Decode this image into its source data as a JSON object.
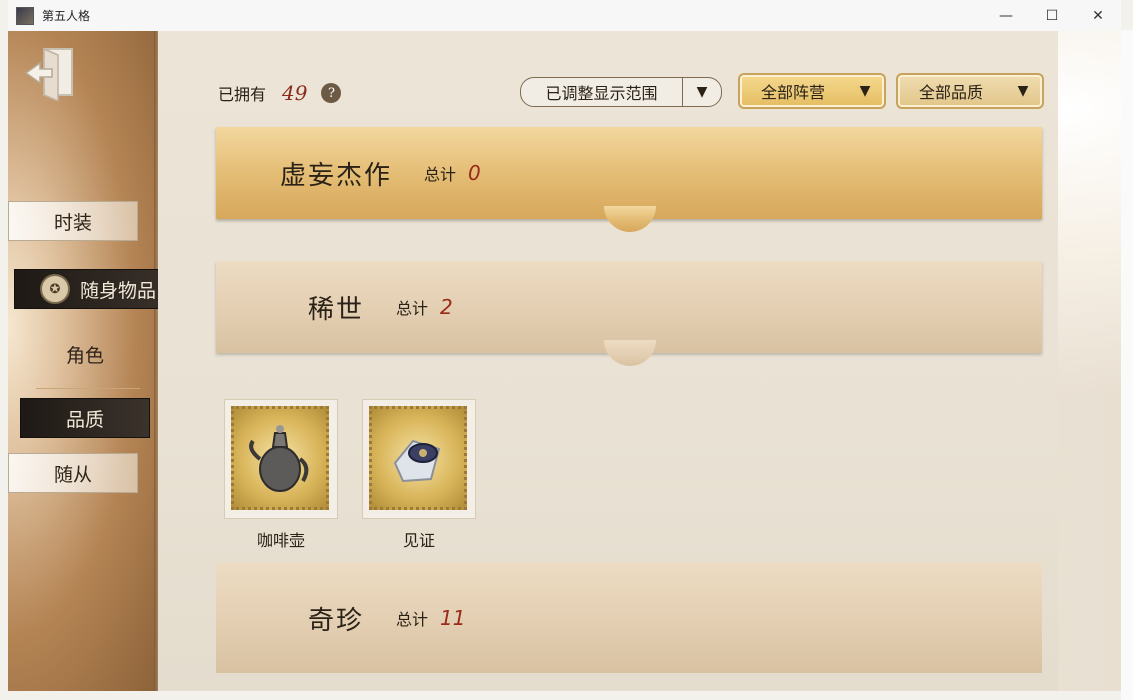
{
  "window": {
    "title": "第五人格",
    "controls": [
      "—",
      "☐",
      "✕"
    ]
  },
  "sidebar": {
    "tabs": [
      {
        "id": "costume",
        "label": "时装"
      },
      {
        "id": "accessories",
        "label": "随身物品"
      },
      {
        "id": "character",
        "label": "角色"
      },
      {
        "id": "quality",
        "label": "品质"
      },
      {
        "id": "follower",
        "label": "随从"
      }
    ]
  },
  "header": {
    "owned_label": "已拥有",
    "owned_count": "49",
    "help_icon": "?",
    "range_dropdown": "已调整显示范围",
    "camp_dropdown": "全部阵营",
    "quality_dropdown": "全部品质"
  },
  "categories": [
    {
      "name": "虚妄杰作",
      "total_label": "总计",
      "total": "0"
    },
    {
      "name": "稀世",
      "total_label": "总计",
      "total": "2"
    },
    {
      "name": "奇珍",
      "total_label": "总计",
      "total": "11"
    }
  ],
  "items": [
    {
      "name": "咖啡壶",
      "icon": "coffee-pot-icon"
    },
    {
      "name": "见证",
      "icon": "witness-icon"
    }
  ],
  "colors": {
    "accent_red": "#9a2a1a",
    "gold": "#e3bb72",
    "dark_tab": "#2a221c"
  }
}
